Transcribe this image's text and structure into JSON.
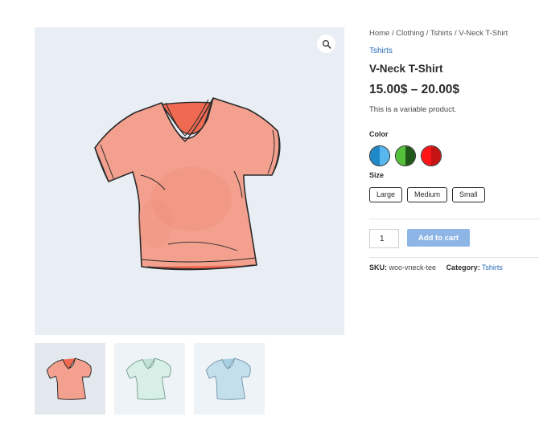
{
  "breadcrumb": {
    "home": "Home",
    "sep": " / ",
    "clothing": "Clothing",
    "tshirts": "Tshirts",
    "current": "V-Neck T-Shirt"
  },
  "product": {
    "category_link": "Tshirts",
    "title": "V-Neck T-Shirt",
    "price": "15.00$ – 20.00$",
    "description": "This is a variable product."
  },
  "attributes": {
    "color_label": "Color",
    "colors": [
      {
        "name": "blue",
        "left": "#1e88c8",
        "right": "#57b7ee"
      },
      {
        "name": "green",
        "left": "#55c13b",
        "right": "#20581a"
      },
      {
        "name": "red",
        "left": "#ff1515",
        "right": "#c41414"
      }
    ],
    "size_label": "Size",
    "sizes": [
      "Large",
      "Medium",
      "Small"
    ]
  },
  "cart": {
    "quantity": "1",
    "add_label": "Add to cart"
  },
  "meta": {
    "sku_label": "SKU:",
    "sku_value": "woo-vneck-tee",
    "category_label": "Category:",
    "category_value": "Tshirts"
  },
  "gallery": {
    "images": [
      {
        "name": "coral",
        "fill": "#f3a08e",
        "shade": "#f07a62"
      },
      {
        "name": "mint",
        "fill": "#d8efe7",
        "shade": "#c0e3d6"
      },
      {
        "name": "sky",
        "fill": "#c4dfec",
        "shade": "#a9cfe2"
      }
    ]
  }
}
